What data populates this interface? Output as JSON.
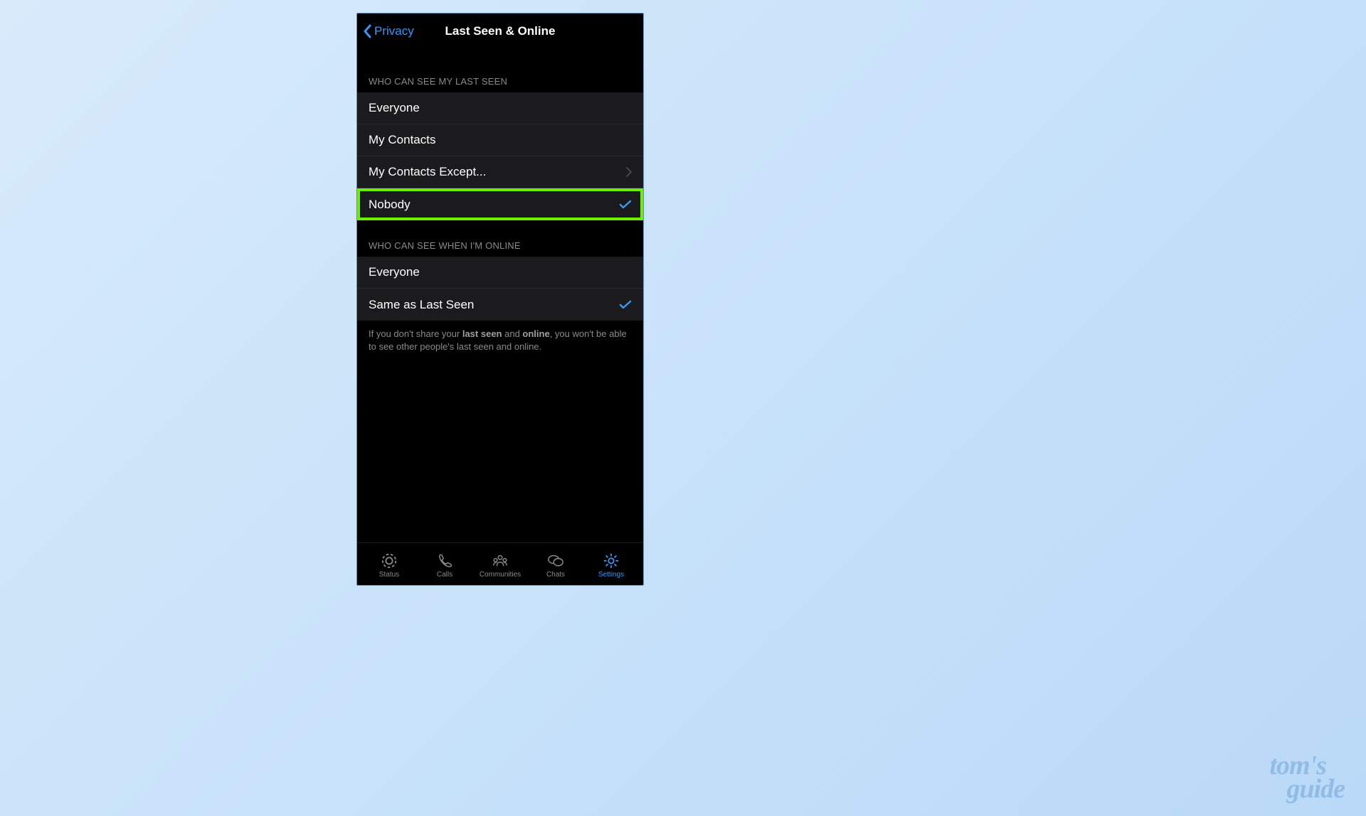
{
  "header": {
    "back_label": "Privacy",
    "title": "Last Seen & Online"
  },
  "sections": {
    "last_seen": {
      "header": "WHO CAN SEE MY LAST SEEN",
      "options": {
        "everyone": "Everyone",
        "my_contacts": "My Contacts",
        "my_contacts_except": "My Contacts Except...",
        "nobody": "Nobody"
      },
      "selected": "nobody",
      "highlighted": "nobody"
    },
    "online": {
      "header": "WHO CAN SEE WHEN I'M ONLINE",
      "options": {
        "everyone": "Everyone",
        "same_as_last_seen": "Same as Last Seen"
      },
      "selected": "same_as_last_seen"
    }
  },
  "footer_note": {
    "part1": "If you don't share your ",
    "bold1": "last seen",
    "part2": " and ",
    "bold2": "online",
    "part3": ", you won't be able to see other people's last seen and online."
  },
  "tabbar": {
    "status": "Status",
    "calls": "Calls",
    "communities": "Communities",
    "chats": "Chats",
    "settings": "Settings",
    "active": "settings"
  },
  "watermark": {
    "line1": "tom's",
    "line2": "guide"
  },
  "colors": {
    "accent": "#3a96f0",
    "highlight": "#6cf000"
  }
}
